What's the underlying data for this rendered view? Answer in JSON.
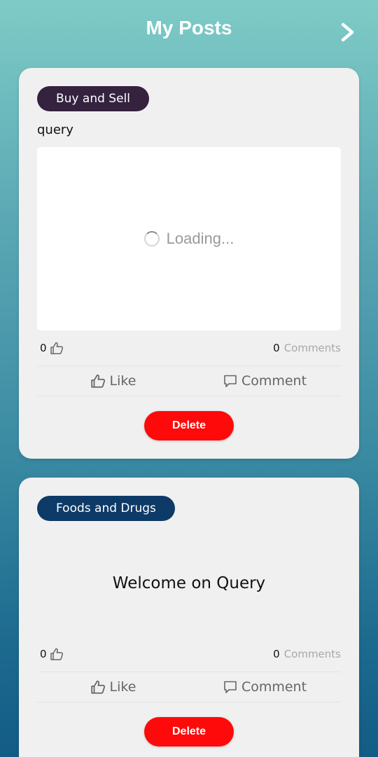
{
  "header": {
    "title": "My Posts",
    "next_icon": "chevron-right-icon"
  },
  "posts": [
    {
      "category": "Buy and Sell",
      "category_color": "#34223f",
      "text": "query",
      "media_status": "Loading...",
      "likes": "0",
      "comments_count": "0",
      "comments_label": "Comments",
      "like_label": "Like",
      "comment_label": "Comment",
      "delete_label": "Delete"
    },
    {
      "category": "Foods and Drugs",
      "category_color": "#0e3a67",
      "text": "Welcome on Query",
      "likes": "0",
      "comments_count": "0",
      "comments_label": "Comments",
      "like_label": "Like",
      "comment_label": "Comment",
      "delete_label": "Delete"
    }
  ],
  "colors": {
    "delete": "#ff0a0a",
    "card": "#f0f0f0"
  }
}
